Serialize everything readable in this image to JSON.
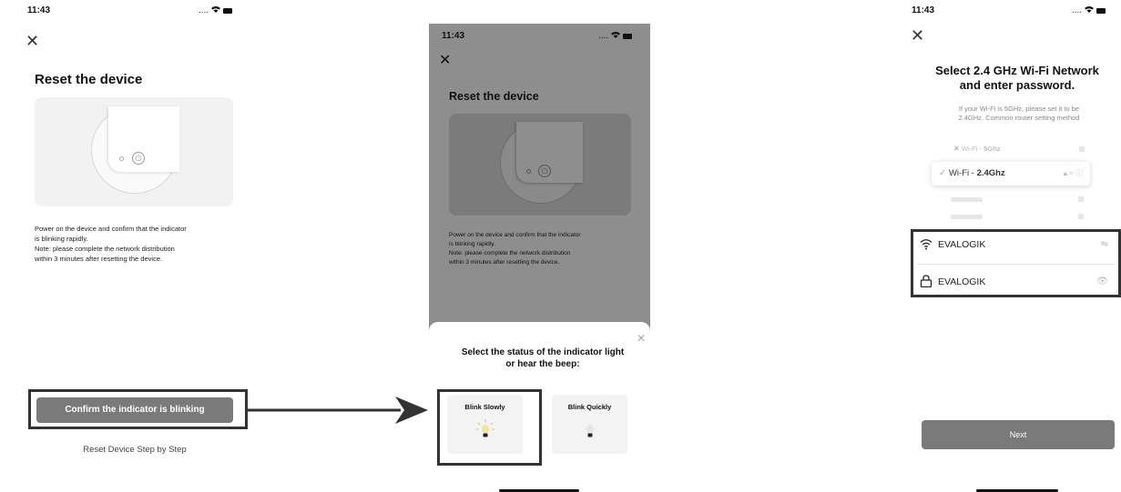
{
  "screen1": {
    "time": "11:43",
    "signal": ".... ",
    "title": "Reset the device",
    "description_lines": [
      "Power on the device and confirm that the indicator",
      "is blinking rapidly.",
      "Note: please complete the network distribution",
      "within 3 minutes after resetting the device."
    ],
    "confirm_button": "Confirm the indicator is blinking",
    "step_link": "Reset Device Step by Step"
  },
  "screen2": {
    "time": "11:43",
    "signal": ".... ",
    "title": "Reset the device",
    "description_lines": [
      "Power on the device and confirm that the indicator",
      "is blinking rapidly.",
      "Note: please complete the network distribution",
      "within 3 minutes after resetting the device."
    ],
    "sheet_title_line1": "Select the status of the indicator light",
    "sheet_title_line2": "or hear the beep:",
    "option_slow": "Blink Slowly",
    "option_quick": "Blink Quickly"
  },
  "screen3": {
    "time": "11:43",
    "signal": ".... ",
    "title_line1": "Select 2.4 GHz Wi-Fi Network",
    "title_line2": "and enter password.",
    "subtitle_line1": "If your Wi-Fi is 5GHz, please set it to be",
    "subtitle_line2": "2.4GHz. Common router setting method",
    "wifi_5g_prefix": "Wi-Fi - ",
    "wifi_5g_band": "5Ghz",
    "wifi_24_prefix": "Wi-Fi - ",
    "wifi_24_band": "2.4Ghz",
    "network_name": "EVALOGIK",
    "password": "EVALOGIK",
    "next_button": "Next"
  },
  "colors": {
    "button_gray": "#7a7a7a",
    "overlay_gray": "#8e8e8e",
    "highlight_outline": "#333333"
  }
}
